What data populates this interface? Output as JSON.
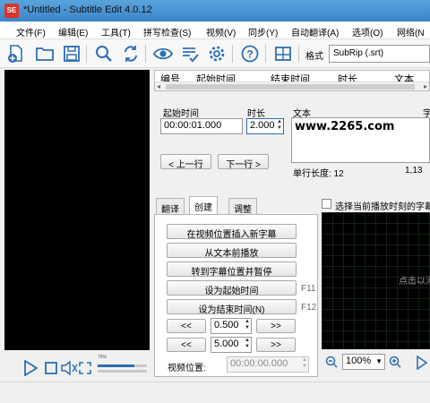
{
  "window": {
    "app_icon_text": "SE",
    "title": "*Untitled - Subtitle Edit 4.0.12"
  },
  "menu": {
    "items": [
      "文件(F)",
      "编辑(E)",
      "工具(T)",
      "拼写检查(S)",
      "视频(V)",
      "同步(Y)",
      "自动翻译(A)",
      "选项(O)",
      "网络(N"
    ]
  },
  "toolbar": {
    "format_label": "格式",
    "format_value": "SubRip (.srt)",
    "icons": [
      "new-file-icon",
      "open-folder-icon",
      "save-icon",
      "find-icon",
      "replace-icon",
      "visual-sync-icon",
      "spell-check-icon",
      "settings-icon",
      "help-icon",
      "layout-icon"
    ]
  },
  "grid": {
    "columns": [
      "编号",
      "起始时间",
      "结束时间",
      "时长",
      "文本"
    ]
  },
  "editor": {
    "start_time_label": "起始时间",
    "start_time_value": "00:00:01.000",
    "duration_label": "时长",
    "duration_value": "2.000",
    "text_label": "文本",
    "text_label2": "字",
    "text_value": "www.2265.com",
    "prev_button": "< 上一行",
    "next_button": "下一行 >",
    "line_length_label": "单行长度: 12",
    "ratio_value": "1,13"
  },
  "tabs": {
    "items": [
      "翻译",
      "创建",
      "调整"
    ],
    "active_index": 1
  },
  "create_tab": {
    "insert_button": "在视频位置插入新字幕",
    "play_from_text_button": "从文本前播放",
    "goto_pause_button": "转到字幕位置并暂停",
    "set_start_button": "设为起始时间",
    "set_start_hint": "F11",
    "set_end_button": "设为结束时间(N)",
    "set_end_hint": "F12",
    "step_back_label": "<<",
    "step_forward_label": ">>",
    "step1_value": "0.500",
    "step2_value": "5.000",
    "video_pos_label": "视频位置:",
    "video_pos_value": "00:00:00.000"
  },
  "waveform": {
    "checkbox_label": "选择当前播放时刻的字幕",
    "message": "点击以添",
    "zoom_value": "100%"
  },
  "player": {
    "volume_percent": 75,
    "volume_text": "75%"
  }
}
